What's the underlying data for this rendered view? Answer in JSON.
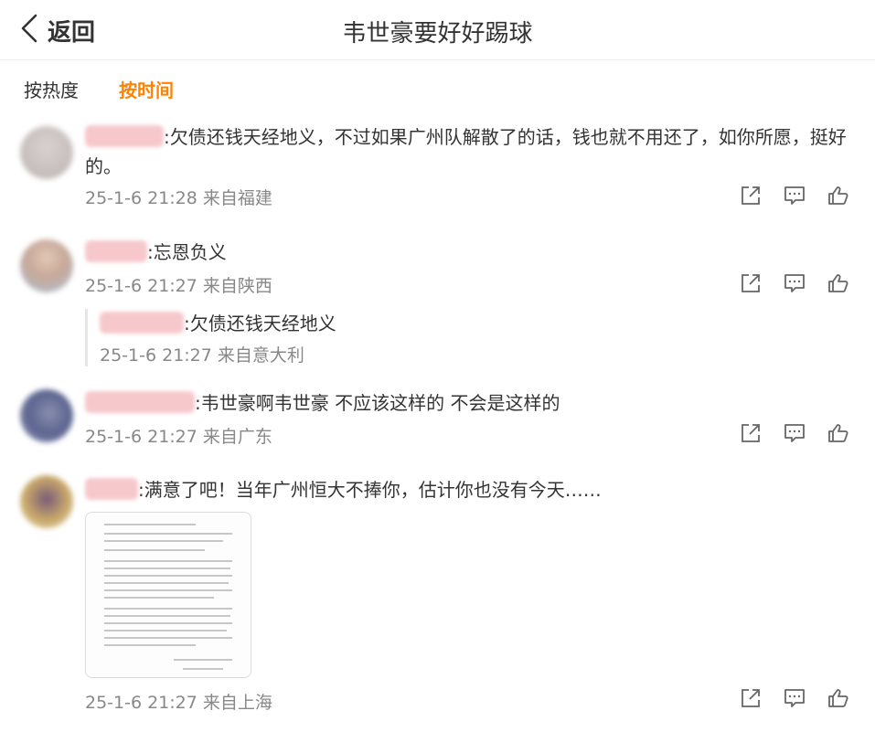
{
  "header": {
    "back_label": "返回",
    "title": "韦世豪要好好踢球"
  },
  "sort_tabs": [
    {
      "label": "按热度",
      "active": false
    },
    {
      "label": "按时间",
      "active": true
    }
  ],
  "comments": [
    {
      "text": ":欠债还钱天经地义，不过如果广州队解散了的话，钱也就不用还了，如你所愿，挺好的。",
      "time": "25-1-6 21:28",
      "location": "来自福建"
    },
    {
      "text": ":忘恩负义",
      "time": "25-1-6 21:27",
      "location": "来自陕西"
    },
    {
      "text": ":韦世豪啊韦世豪 不应该这样的 不会是这样的",
      "time": "25-1-6 21:27",
      "location": "来自广东"
    },
    {
      "text": ":满意了吧！当年广州恒大不捧你，估计你也没有今天……",
      "time": "25-1-6 21:27",
      "location": "来自上海"
    }
  ],
  "reply": {
    "text": ":欠债还钱天经地义",
    "time": "25-1-6 21:27",
    "location": "来自意大利"
  },
  "icons": [
    "back-chevron-icon",
    "share-icon",
    "comment-icon",
    "like-icon"
  ],
  "colors": {
    "accent": "#ff8200",
    "text": "#333333",
    "meta": "#888888",
    "icon": "#666666"
  }
}
